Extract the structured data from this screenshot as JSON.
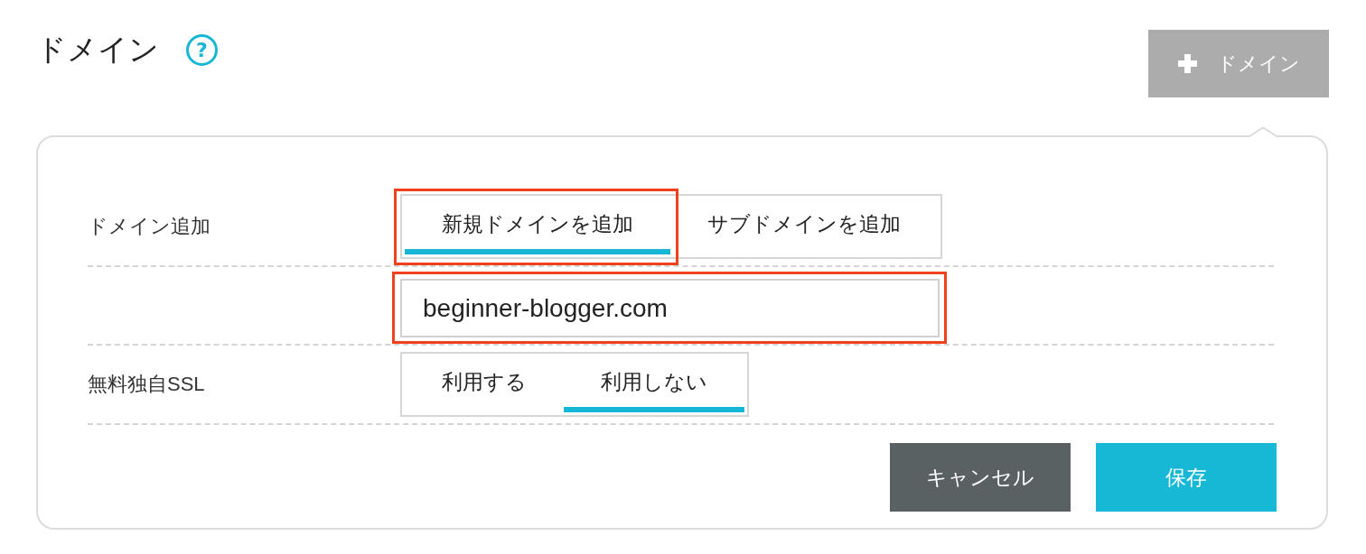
{
  "header": {
    "title": "ドメイン",
    "help_icon": "?",
    "add_button": {
      "label": "ドメイン"
    }
  },
  "form": {
    "rows": [
      {
        "kind": "tabs",
        "label": "ドメイン追加",
        "tabs": [
          {
            "label": "新規ドメインを追加",
            "selected": true,
            "highlighted": true
          },
          {
            "label": "サブドメインを追加",
            "selected": false,
            "highlighted": false
          }
        ]
      },
      {
        "kind": "input",
        "value": "beginner-blogger.com",
        "highlighted": true
      },
      {
        "kind": "tabs",
        "label": "無料独自SSL",
        "tabs": [
          {
            "label": "利用する",
            "selected": false,
            "highlighted": false
          },
          {
            "label": "利用しない",
            "selected": true,
            "highlighted": false
          }
        ]
      }
    ],
    "buttons": [
      {
        "kind": "secondary",
        "label": "キャンセル"
      },
      {
        "kind": "primary",
        "label": "保存"
      }
    ]
  }
}
